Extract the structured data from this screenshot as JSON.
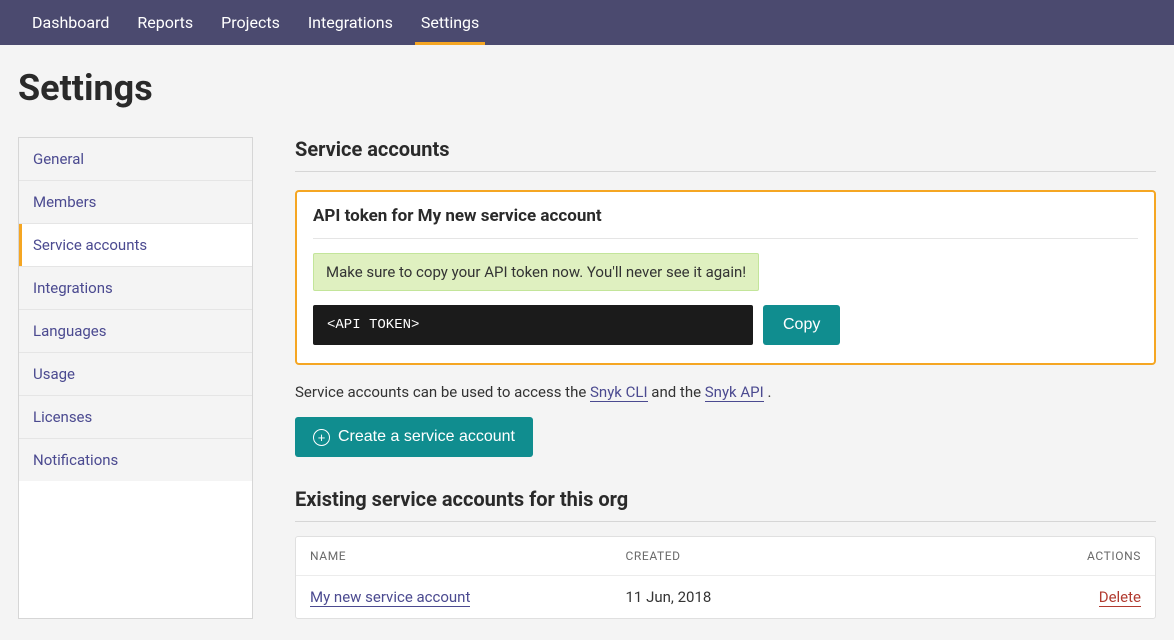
{
  "nav": {
    "items": [
      {
        "label": "Dashboard"
      },
      {
        "label": "Reports"
      },
      {
        "label": "Projects"
      },
      {
        "label": "Integrations"
      },
      {
        "label": "Settings"
      }
    ],
    "activeIndex": 4
  },
  "page": {
    "title": "Settings"
  },
  "sidebar": {
    "items": [
      {
        "label": "General"
      },
      {
        "label": "Members"
      },
      {
        "label": "Service accounts"
      },
      {
        "label": "Integrations"
      },
      {
        "label": "Languages"
      },
      {
        "label": "Usage"
      },
      {
        "label": "Licenses"
      },
      {
        "label": "Notifications"
      }
    ],
    "activeIndex": 2
  },
  "section": {
    "title": "Service accounts"
  },
  "token": {
    "title": "API token for My new service account",
    "warning": "Make sure to copy your API token now. You'll never see it again!",
    "value": "<API TOKEN>",
    "copy_label": "Copy"
  },
  "description": {
    "prefix": "Service accounts can be used to access the ",
    "link1": "Snyk CLI",
    "mid": " and the ",
    "link2": "Snyk API",
    "suffix": " ."
  },
  "create_button": {
    "label": "Create a service account"
  },
  "existing": {
    "title": "Existing service accounts for this org",
    "columns": {
      "name": "NAME",
      "created": "CREATED",
      "actions": "ACTIONS"
    },
    "rows": [
      {
        "name": "My new service account",
        "created": "11 Jun, 2018",
        "action": "Delete"
      }
    ]
  }
}
